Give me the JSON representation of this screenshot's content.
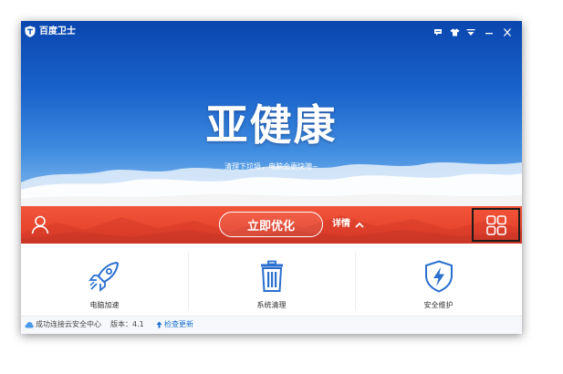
{
  "app": {
    "title": "百度卫士"
  },
  "titlebar": {
    "icons": [
      "feedback-icon",
      "skin-icon",
      "menu-icon",
      "minimize-icon",
      "close-icon"
    ]
  },
  "hero": {
    "headline": "亚健康",
    "subtitle": "清理下垃圾，电脑会更快噢~"
  },
  "actionbar": {
    "optimize_label": "立即优化",
    "details_label": "详情"
  },
  "tools": [
    {
      "label": "电脑加速",
      "icon": "rocket-icon"
    },
    {
      "label": "系统清理",
      "icon": "trash-icon"
    },
    {
      "label": "安全维护",
      "icon": "shield-icon"
    }
  ],
  "statusbar": {
    "cloud_status": "成功连接云安全中心",
    "version": "版本：4.1",
    "update_label": "检查更新"
  },
  "colors": {
    "accent_red": "#e8452e",
    "hero_blue": "#1a63cc",
    "icon_blue": "#2a6fcf",
    "link_blue": "#1a6fd0"
  }
}
